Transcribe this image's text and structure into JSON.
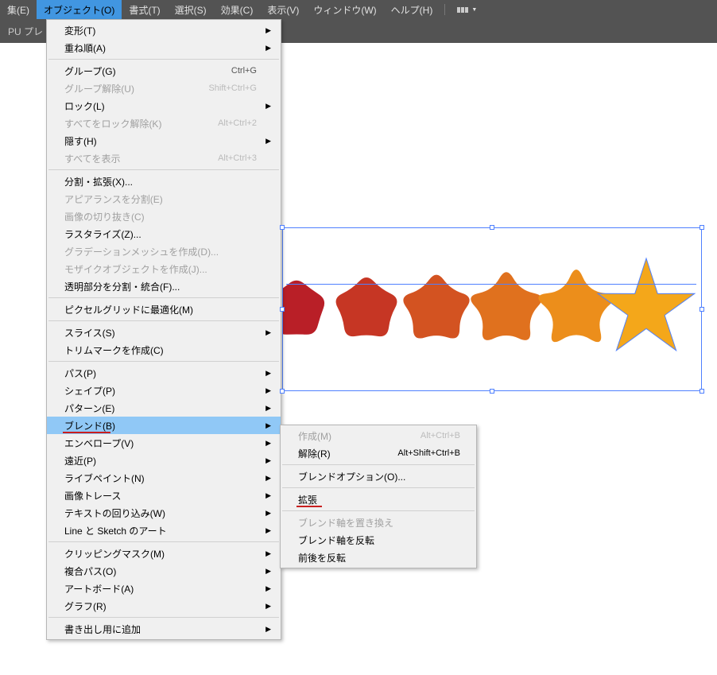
{
  "menubar": {
    "items": [
      {
        "label": "集(E)"
      },
      {
        "label": "オブジェクト(O)"
      },
      {
        "label": "書式(T)"
      },
      {
        "label": "選択(S)"
      },
      {
        "label": "効果(C)"
      },
      {
        "label": "表示(V)"
      },
      {
        "label": "ウィンドウ(W)"
      },
      {
        "label": "ヘルプ(H)"
      }
    ]
  },
  "toolstrip": {
    "text": "PU プレ"
  },
  "object_menu": {
    "groups": [
      [
        {
          "label": "変形(T)",
          "submenu": true
        },
        {
          "label": "重ね順(A)",
          "submenu": true
        }
      ],
      [
        {
          "label": "グループ(G)",
          "shortcut": "Ctrl+G"
        },
        {
          "label": "グループ解除(U)",
          "shortcut": "Shift+Ctrl+G",
          "disabled": true
        },
        {
          "label": "ロック(L)",
          "submenu": true
        },
        {
          "label": "すべてをロック解除(K)",
          "shortcut": "Alt+Ctrl+2",
          "disabled": true
        },
        {
          "label": "隠す(H)",
          "submenu": true
        },
        {
          "label": "すべてを表示",
          "shortcut": "Alt+Ctrl+3",
          "disabled": true
        }
      ],
      [
        {
          "label": "分割・拡張(X)..."
        },
        {
          "label": "アピアランスを分割(E)",
          "disabled": true
        },
        {
          "label": "画像の切り抜き(C)",
          "disabled": true
        },
        {
          "label": "ラスタライズ(Z)..."
        },
        {
          "label": "グラデーションメッシュを作成(D)...",
          "disabled": true
        },
        {
          "label": "モザイクオブジェクトを作成(J)...",
          "disabled": true
        },
        {
          "label": "透明部分を分割・統合(F)..."
        }
      ],
      [
        {
          "label": "ピクセルグリッドに最適化(M)"
        }
      ],
      [
        {
          "label": "スライス(S)",
          "submenu": true
        },
        {
          "label": "トリムマークを作成(C)"
        }
      ],
      [
        {
          "label": "パス(P)",
          "submenu": true
        },
        {
          "label": "シェイプ(P)",
          "submenu": true
        },
        {
          "label": "パターン(E)",
          "submenu": true
        },
        {
          "label": "ブレンド(B)",
          "submenu": true,
          "highlight": true,
          "redline": true
        },
        {
          "label": "エンベロープ(V)",
          "submenu": true
        },
        {
          "label": "遠近(P)",
          "submenu": true
        },
        {
          "label": "ライブペイント(N)",
          "submenu": true
        },
        {
          "label": "画像トレース",
          "submenu": true
        },
        {
          "label": "テキストの回り込み(W)",
          "submenu": true
        },
        {
          "label": "Line と Sketch のアート",
          "submenu": true
        }
      ],
      [
        {
          "label": "クリッピングマスク(M)",
          "submenu": true
        },
        {
          "label": "複合パス(O)",
          "submenu": true
        },
        {
          "label": "アートボード(A)",
          "submenu": true
        },
        {
          "label": "グラフ(R)",
          "submenu": true
        }
      ],
      [
        {
          "label": "書き出し用に追加",
          "submenu": true
        }
      ]
    ]
  },
  "blend_submenu": {
    "groups": [
      [
        {
          "label": "作成(M)",
          "shortcut": "Alt+Ctrl+B",
          "disabled": true
        },
        {
          "label": "解除(R)",
          "shortcut": "Alt+Shift+Ctrl+B"
        }
      ],
      [
        {
          "label": "ブレンドオプション(O)..."
        }
      ],
      [
        {
          "label": "拡張",
          "redline": true
        }
      ],
      [
        {
          "label": "ブレンド軸を置き換え",
          "disabled": true
        },
        {
          "label": "ブレンド軸を反転"
        },
        {
          "label": "前後を反転"
        }
      ]
    ]
  },
  "artwork": {
    "colors": [
      "#b91f27",
      "#c63624",
      "#d35321",
      "#e0711e",
      "#ec8e1b",
      "#f4a71a"
    ]
  }
}
